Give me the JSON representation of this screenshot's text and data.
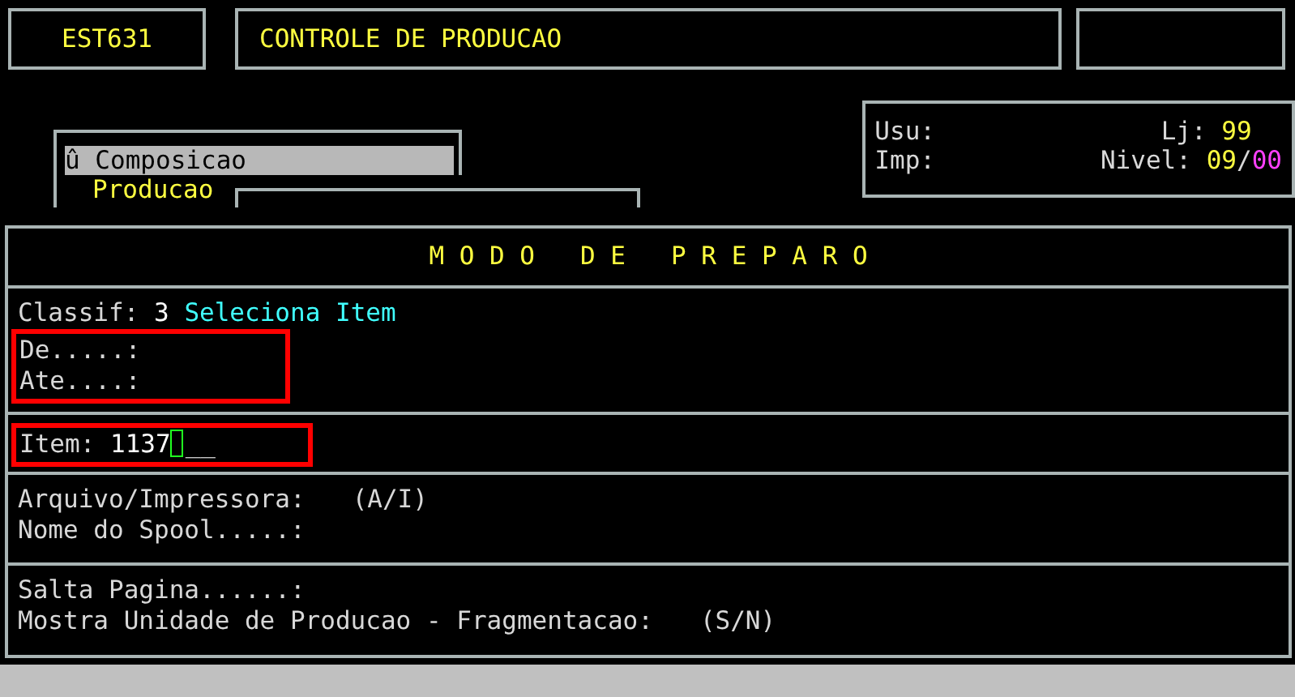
{
  "header": {
    "code": "EST631",
    "title": "CONTROLE DE PRODUCAO"
  },
  "menu": {
    "items": [
      {
        "label": "û Composicao",
        "selected": true
      },
      {
        "label": "Producao",
        "selected": false
      }
    ]
  },
  "info": {
    "usu_label": "Usu:",
    "lj_label": "Lj:",
    "lj_value": "99",
    "imp_label": "Imp:",
    "nivel_label": "Nivel:",
    "nivel_value": "09",
    "nivel_separator": "/",
    "nivel_sub": "00"
  },
  "panel": {
    "title": "M O D O   D E   P R E P A R O",
    "classif": {
      "label": "Classif:",
      "value": "3",
      "description": "Seleciona Item"
    },
    "range": {
      "highlighted": true,
      "fields": [
        "De.....:",
        "Ate....:"
      ]
    },
    "item": {
      "highlighted": true,
      "label": "Item:",
      "value": "1137",
      "filler": "__"
    },
    "output": [
      {
        "label": "Arquivo/Impressora:",
        "hint": "(A/I)"
      },
      {
        "label": "Nome do Spool.....:"
      }
    ],
    "options": [
      {
        "label": "Salta Pagina......:"
      },
      {
        "label": "Mostra Unidade de Producao - Fragmentacao:",
        "hint": "(S/N)"
      }
    ]
  }
}
